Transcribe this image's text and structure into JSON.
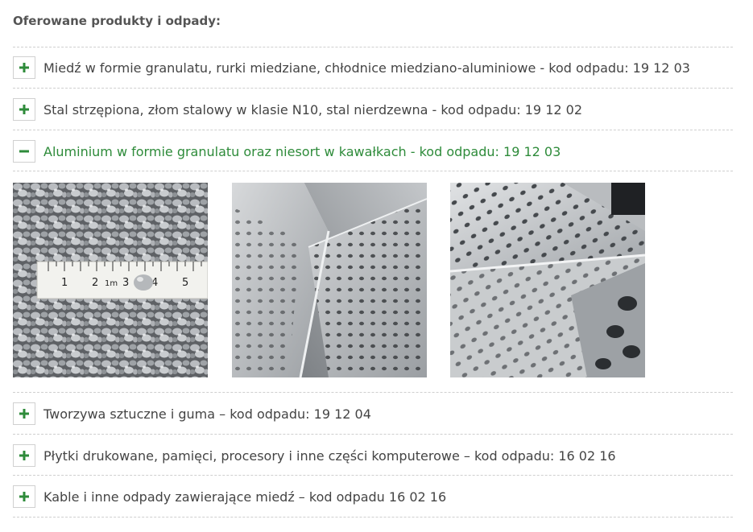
{
  "heading": "Oferowane produkty i odpady:",
  "accent_color": "#2e8b3a",
  "items": [
    {
      "label": "Miedź w formie granulatu, rurki miedziane, chłodnice miedziano-aluminiowe - kod odpadu: 19 12 03",
      "expanded": false,
      "icon": "plus-icon"
    },
    {
      "label": "Stal strzępiona, złom stalowy w klasie N10, stal nierdzewna - kod odpadu: 19 12 02",
      "expanded": false,
      "icon": "plus-icon"
    },
    {
      "label": "Aluminium w formie granulatu oraz niesort w kawałkach - kod odpadu: 19 12 03",
      "expanded": true,
      "icon": "minus-icon"
    },
    {
      "label": "Tworzywa sztuczne i guma – kod odpadu: 19 12 04",
      "expanded": false,
      "icon": "plus-icon"
    },
    {
      "label": "Płytki drukowane, pamięci, procesory i inne części komputerowe – kod odpadu: 16 02 16",
      "expanded": false,
      "icon": "plus-icon"
    },
    {
      "label": "Kable i inne odpady zawierające miedź – kod odpadu 16 02 16",
      "expanded": false,
      "icon": "plus-icon"
    }
  ],
  "gallery": {
    "images": [
      {
        "name": "aluminium-granulate-photo",
        "ruler_labels": [
          "1",
          "2",
          "1m",
          "3",
          "4",
          "5"
        ]
      },
      {
        "name": "perforated-aluminium-scrap-photo-1"
      },
      {
        "name": "perforated-aluminium-scrap-photo-2"
      }
    ]
  }
}
